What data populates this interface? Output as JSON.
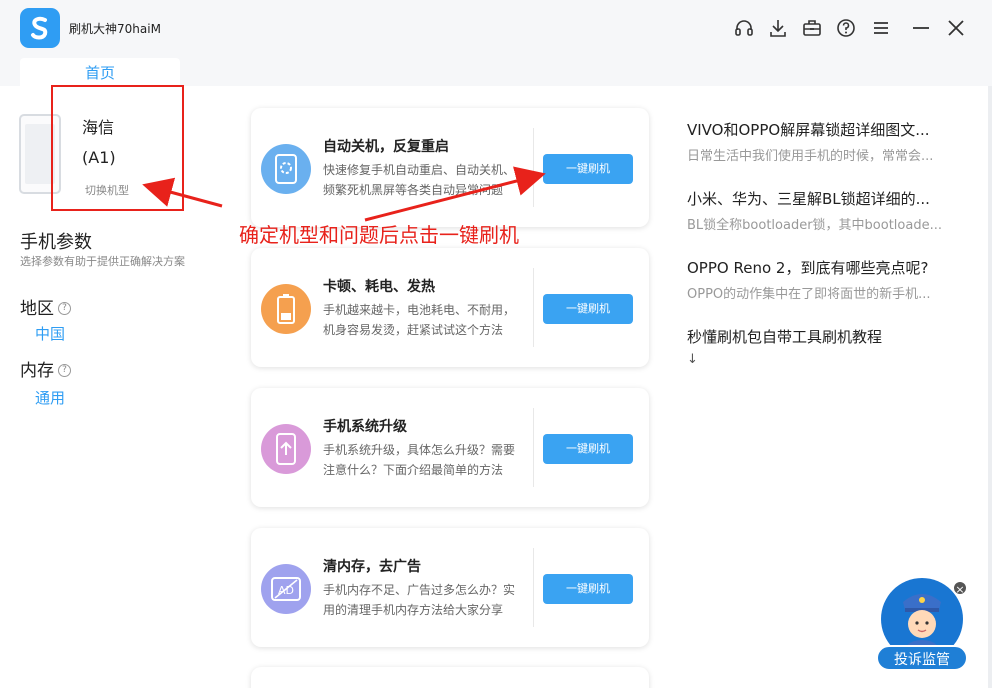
{
  "app": {
    "title": "刷机大神70haiM",
    "tab_home": "首页"
  },
  "window_icons": [
    "headset-icon",
    "download-icon",
    "toolbox-icon",
    "help-icon",
    "menu-icon",
    "minimize-icon",
    "close-icon"
  ],
  "device": {
    "brand": "海信",
    "model": "(A1)",
    "switch_label": "切换机型"
  },
  "params": {
    "title": "手机参数",
    "subtitle": "选择参数有助于提供正确解决方案",
    "region_label": "地区",
    "region_value": "中国",
    "memory_label": "内存",
    "memory_value": "通用"
  },
  "annotation": "确定机型和问题后点击一键刷机",
  "cards": [
    {
      "title": "自动关机，反复重启",
      "desc": "快速修复手机自动重启、自动关机、频繁死机黑屏等各类自动异常问题",
      "button": "一键刷机",
      "icon": "auto-restart-icon",
      "color": "#6ab0ef"
    },
    {
      "title": "卡顿、耗电、发热",
      "desc": "手机越来越卡，电池耗电、不耐用，机身容易发烫，赶紧试试这个方法",
      "button": "一键刷机",
      "icon": "battery-icon",
      "color": "#f5a04f"
    },
    {
      "title": "手机系统升级",
      "desc": "手机系统升级，具体怎么升级？需要注意什么？下面介绍最简单的方法",
      "button": "一键刷机",
      "icon": "phone-upgrade-icon",
      "color": "#d99ad9"
    },
    {
      "title": "清内存，去广告",
      "desc": "手机内存不足、广告过多怎么办？实用的清理手机内存方法给大家分享",
      "button": "一键刷机",
      "icon": "no-ad-icon",
      "color": "#9fa2ee"
    }
  ],
  "articles": [
    {
      "title": "VIVO和OPPO解屏幕锁超详细图文...",
      "desc": "日常生活中我们使用手机的时候，常常会..."
    },
    {
      "title": "小米、华为、三星解BL锁超详细的...",
      "desc": "BL锁全称bootloader锁，其中bootloade..."
    },
    {
      "title": "OPPO Reno 2，到底有哪些亮点呢?",
      "desc": "OPPO的动作集中在了即将面世的新手机..."
    },
    {
      "title": "秒懂刷机包自带工具刷机教程",
      "desc": "↓"
    }
  ],
  "support": {
    "label": "投诉监管",
    "close": "×"
  },
  "colors": {
    "accent": "#2f9df3",
    "annotation_red": "#e8221b",
    "button": "#3aa3f2"
  }
}
